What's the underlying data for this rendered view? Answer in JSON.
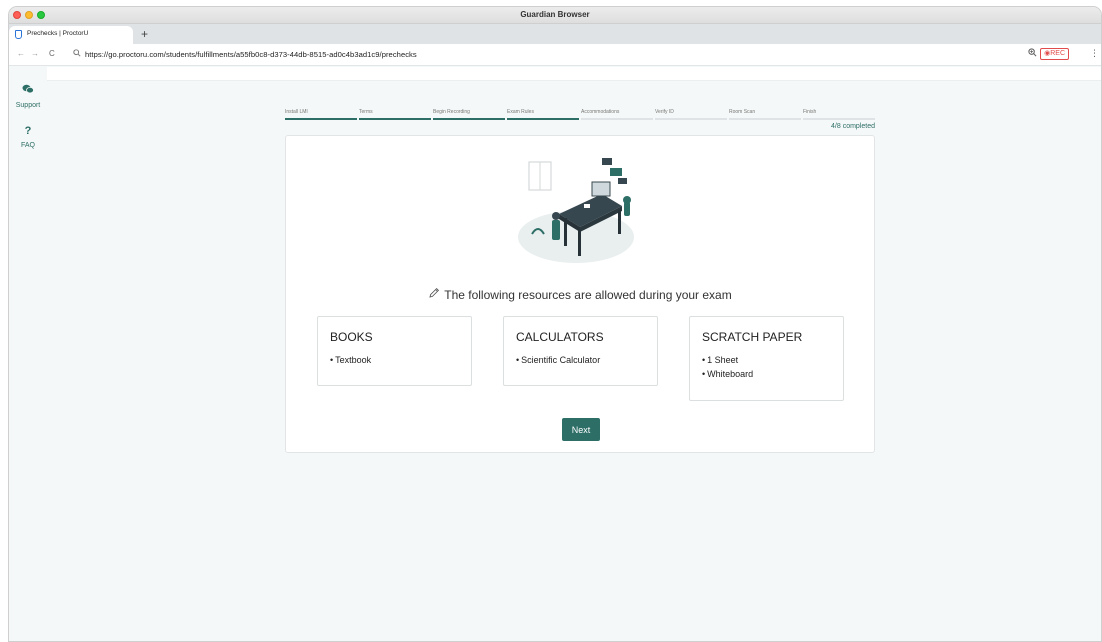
{
  "window": {
    "title": "Guardian Browser"
  },
  "tab": {
    "title": "Prechecks | ProctorU",
    "new_tab": "+"
  },
  "nav": {
    "back": "←",
    "forward": "→",
    "reload": "C",
    "url": "https://go.proctoru.com/students/fulfillments/a55fb0c8-d373-44db-8515-ad0c4b3ad1c9/prechecks",
    "rec_label": "REC"
  },
  "sidebar": {
    "items": [
      {
        "label": "Support",
        "icon": "chat-bubbles-icon"
      },
      {
        "label": "FAQ",
        "icon": "question-mark-icon",
        "glyph": "?"
      }
    ]
  },
  "steps": {
    "items": [
      {
        "label": "Install LMI",
        "done": true
      },
      {
        "label": "Terms",
        "done": true
      },
      {
        "label": "Begin Recording",
        "done": true
      },
      {
        "label": "Exam Rules",
        "done": true
      },
      {
        "label": "Accommodations",
        "done": false
      },
      {
        "label": "Verify ID",
        "done": false
      },
      {
        "label": "Room Scan",
        "done": false
      },
      {
        "label": "Finish",
        "done": false
      }
    ],
    "progress_text": "4/8 completed"
  },
  "main": {
    "heading": "The following resources are allowed during your exam",
    "resources": [
      {
        "title": "BOOKS",
        "items": [
          "Textbook"
        ]
      },
      {
        "title": "CALCULATORS",
        "items": [
          "Scientific Calculator"
        ]
      },
      {
        "title": "SCRATCH PAPER",
        "items": [
          "1 Sheet",
          "Whiteboard"
        ]
      }
    ],
    "next_label": "Next"
  },
  "colors": {
    "accent": "#2d6e67",
    "rec": "#e24b4b",
    "progress_track": "#dfe3e5"
  }
}
